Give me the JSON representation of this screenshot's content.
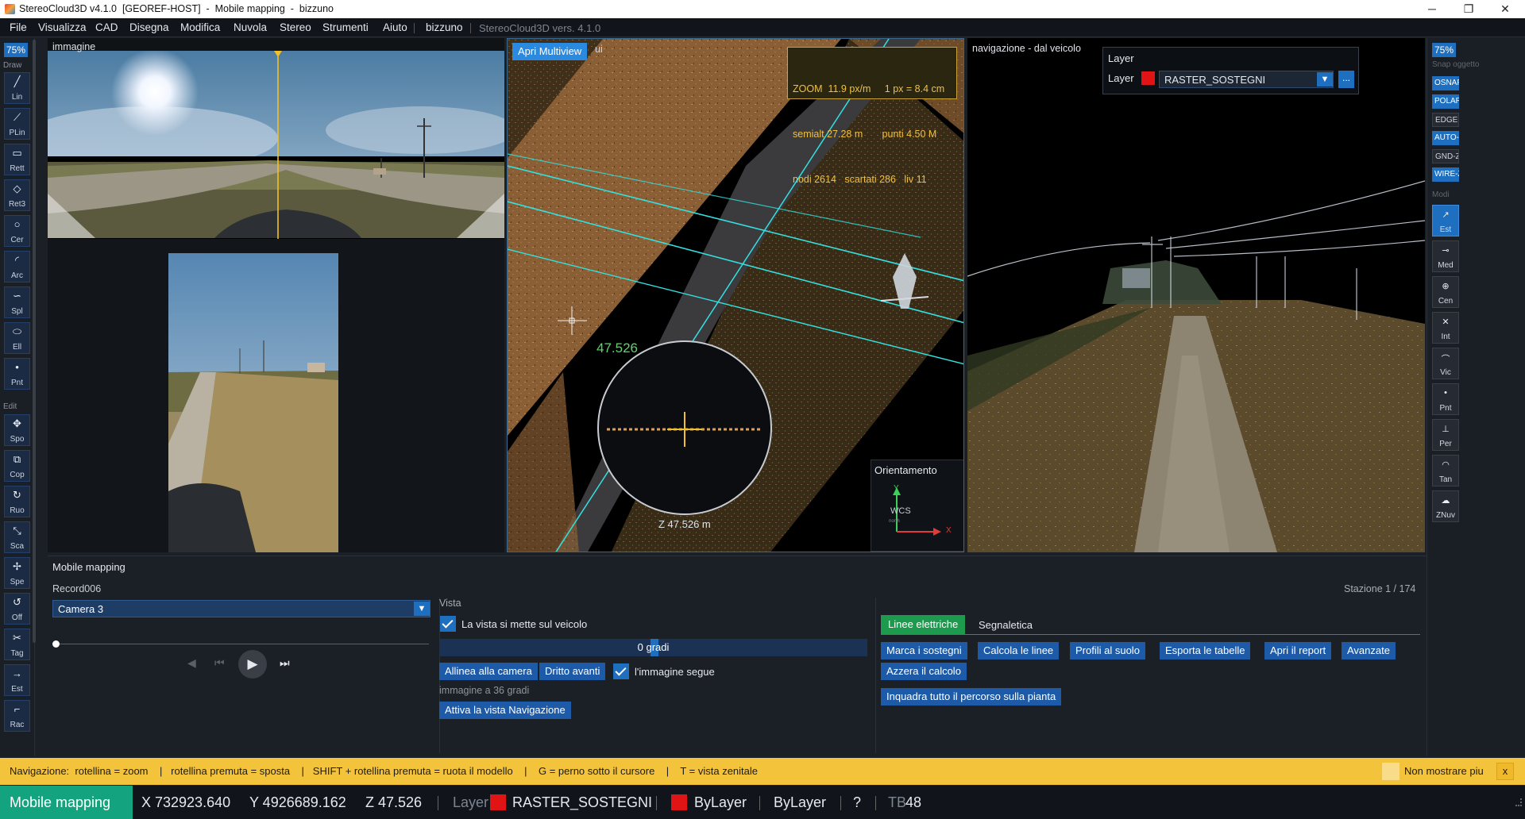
{
  "window": {
    "title": "StereoCloud3D v4.1.0  [GEOREF-HOST]  -  Mobile mapping  -  bizzuno",
    "minimize": "─",
    "maximize": "❐",
    "close": "✕"
  },
  "menu": {
    "items": [
      "File",
      "Visualizza",
      "CAD",
      "Disegna",
      "Modifica",
      "Nuvola",
      "Stereo",
      "Strumenti",
      "Aiuto"
    ],
    "user": "bizzuno",
    "version": "StereoCloud3D vers. 4.1.0"
  },
  "left_toolbar": {
    "zoom": "75%",
    "draw_header": "Draw",
    "edit_header": "Edit",
    "draw_tools": [
      {
        "icon": "line-icon",
        "glyph": "╱",
        "label": "Lin"
      },
      {
        "icon": "polyline-icon",
        "glyph": "⟋",
        "label": "PLin"
      },
      {
        "icon": "rectangle-icon",
        "glyph": "▭",
        "label": "Rett"
      },
      {
        "icon": "rectangle3-icon",
        "glyph": "◇",
        "label": "Ret3"
      },
      {
        "icon": "circle-icon",
        "glyph": "○",
        "label": "Cer"
      },
      {
        "icon": "arc-icon",
        "glyph": "◜",
        "label": "Arc"
      },
      {
        "icon": "spline-icon",
        "glyph": "∽",
        "label": "Spl"
      },
      {
        "icon": "ellipse-icon",
        "glyph": "⬭",
        "label": "Ell"
      },
      {
        "icon": "point-icon",
        "glyph": "•",
        "label": "Pnt"
      }
    ],
    "edit_tools": [
      {
        "icon": "move-icon",
        "glyph": "✥",
        "label": "Spo"
      },
      {
        "icon": "copy-icon",
        "glyph": "⧉",
        "label": "Cop"
      },
      {
        "icon": "rotate-icon",
        "glyph": "↻",
        "label": "Ruo"
      },
      {
        "icon": "scale-icon",
        "glyph": "⤡",
        "label": "Sca"
      },
      {
        "icon": "mirror-icon",
        "glyph": "✢",
        "label": "Spe"
      },
      {
        "icon": "offset-icon",
        "glyph": "↺",
        "label": "Off"
      },
      {
        "icon": "trim-icon",
        "glyph": "✂",
        "label": "Tag"
      },
      {
        "icon": "extend-icon",
        "glyph": "→",
        "label": "Est"
      },
      {
        "icon": "fillet-icon",
        "glyph": "⌐",
        "label": "Rac"
      }
    ]
  },
  "right_toolbar": {
    "zoom": "75%",
    "snap_header": "Snap oggetto",
    "modes_header": "Modi",
    "snaps": [
      {
        "label": "OSNAP",
        "on": true
      },
      {
        "label": "POLAR",
        "on": true
      },
      {
        "label": "EDGE",
        "on": false
      },
      {
        "label": "AUTO-Z",
        "on": true
      },
      {
        "label": "GND-Z",
        "on": false
      },
      {
        "label": "WIRE-Z",
        "on": true
      }
    ],
    "modes": [
      {
        "icon": "endpoint-icon",
        "glyph": "↗",
        "label": "Est",
        "on": true
      },
      {
        "icon": "midpoint-icon",
        "glyph": "⊸",
        "label": "Med",
        "on": false
      },
      {
        "icon": "center-icon",
        "glyph": "⊕",
        "label": "Cen",
        "on": false
      },
      {
        "icon": "intersection-icon",
        "glyph": "✕",
        "label": "Int",
        "on": false
      },
      {
        "icon": "nearest-icon",
        "glyph": "⌒",
        "label": "Vic",
        "on": false
      },
      {
        "icon": "node-icon",
        "glyph": "•",
        "label": "Pnt",
        "on": false
      },
      {
        "icon": "perpendicular-icon",
        "glyph": "⊥",
        "label": "Per",
        "on": false
      },
      {
        "icon": "tangent-icon",
        "glyph": "◠",
        "label": "Tan",
        "on": false
      },
      {
        "icon": "cloud-z-icon",
        "glyph": "☁",
        "label": "ZNuv",
        "on": false
      }
    ]
  },
  "panels": {
    "image_label": "immagine",
    "map": {
      "button": "Apri Multiview",
      "hidden_label_fragment": "ui",
      "info_line1": "ZOOM  11.9 px/m     1 px = 8.4 cm",
      "info_line2": "semialt 27.28 m       punti 4.50 M",
      "info_line3": "nodi 2614   scartati 286   liv 11",
      "cursor_value": "47.526",
      "loupe_z": "Z 47.526 m",
      "orientation_title": "Orientamento",
      "axis_y": "Y",
      "axis_x": "X",
      "wcs": "WCS",
      "axis_sub": "north"
    },
    "nav": {
      "label": "navigazione - dal veicolo",
      "layer_title": "Layer",
      "layer_label": "Layer",
      "layer_value": "RASTER_SOSTEGNI",
      "layer_more": "...",
      "layer_color": "#e01414"
    }
  },
  "bottom": {
    "title": "Mobile mapping",
    "record": "Record006",
    "station": "Stazione 1 / 174",
    "camera": "Camera 3",
    "slider_position": 0.0,
    "vista": {
      "header": "Vista",
      "follow_vehicle": "La vista si mette sul veicolo",
      "angle": "0 gradi",
      "align_camera": "Allinea alla camera",
      "straight_ahead": "Dritto avanti",
      "image_follows": "l'immagine segue",
      "image_angle": "immagine a 36 gradi",
      "activate_nav": "Attiva la vista Navigazione"
    },
    "tabs": [
      "Linee elettriche",
      "Segnaletica"
    ],
    "actions": [
      "Marca i sostegni",
      "Calcola le linee",
      "Profili al suolo",
      "Esporta le tabelle",
      "Apri il report",
      "Avanzate"
    ],
    "reset": "Azzera il calcolo",
    "frame_path": "Inquadra tutto il percorso sulla pianta"
  },
  "hint": {
    "text": "Navigazione:  rotellina = zoom    |   rotellina premuta = sposta    |   SHIFT + rotellina premuta = ruota il modello    |    G = perno sotto il cursore    |    T = vista zenitale",
    "dont_show": "Non mostrare piu",
    "close": "x"
  },
  "status": {
    "mode": "Mobile mapping",
    "x": "X 732923.640",
    "y": "Y 4926689.162",
    "z": "Z 47.526",
    "layer_label": "Layer",
    "layer": "RASTER_SOSTEGNI",
    "color": "ByLayer",
    "linetype": "ByLayer",
    "help": "?",
    "tb_prefix": "TB",
    "tb_value": "48",
    "accent": "#14a37f"
  },
  "colors": {
    "accent_blue": "#1f6fc0",
    "button_blue": "#1d5aa8",
    "tab_green": "#1e9a4e",
    "hint_yellow": "#f3c43b",
    "status_green": "#14a37f",
    "info_gold": "#f0c040",
    "wire_cyan": "#34e0e0"
  }
}
